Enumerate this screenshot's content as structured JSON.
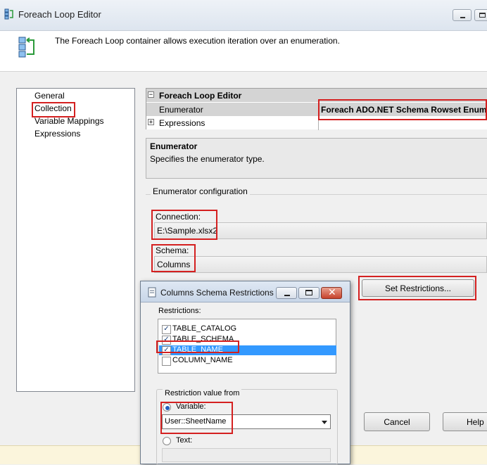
{
  "window": {
    "title": "Foreach Loop Editor",
    "description": "The Foreach Loop container allows execution iteration over an enumeration."
  },
  "nav": {
    "items": [
      {
        "label": "General"
      },
      {
        "label": "Collection"
      },
      {
        "label": "Variable Mappings"
      },
      {
        "label": "Expressions"
      }
    ]
  },
  "property_grid": {
    "category": "Foreach Loop Editor",
    "rows": [
      {
        "name": "Enumerator",
        "value": "Foreach ADO.NET Schema Rowset Enumerator"
      },
      {
        "name": "Expressions",
        "value": ""
      }
    ],
    "expand_glyph": "⊞"
  },
  "description": {
    "title": "Enumerator",
    "text": "Specifies the enumerator type."
  },
  "config": {
    "group_label": "Enumerator configuration",
    "connection_label": "Connection:",
    "connection_value": "E:\\Sample.xlsx2",
    "schema_label": "Schema:",
    "schema_value": "Columns",
    "set_restrictions_label": "Set Restrictions..."
  },
  "buttons": {
    "cancel": "Cancel",
    "help": "Help"
  },
  "dialog": {
    "title": "Columns Schema Restrictions",
    "restrictions_label": "Restrictions:",
    "items": [
      {
        "label": "TABLE_CATALOG",
        "checked": true
      },
      {
        "label": "TABLE_SCHEMA",
        "checked": true
      },
      {
        "label": "TABLE_NAME",
        "checked": true
      },
      {
        "label": "COLUMN_NAME",
        "checked": false
      }
    ],
    "restriction_value_label": "Restriction value from",
    "variable_label": "Variable:",
    "variable_value": "User::SheetName",
    "text_label": "Text:",
    "check_glyph": "✓"
  },
  "colors": {
    "highlight": "#d42020",
    "selection": "#3399ff"
  }
}
